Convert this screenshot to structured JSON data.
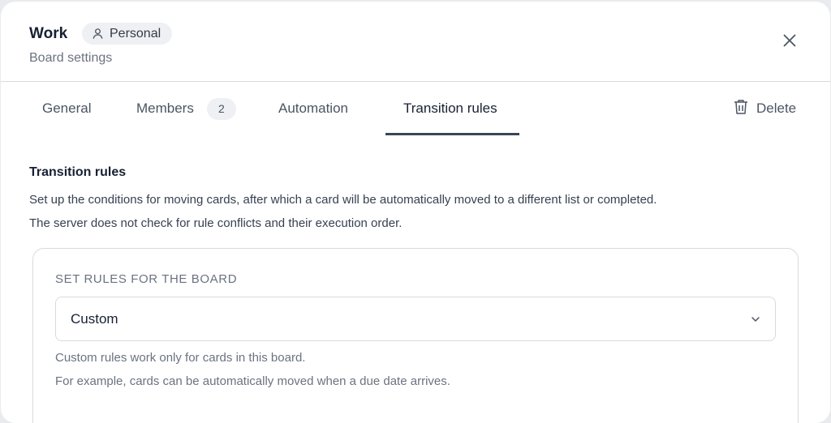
{
  "header": {
    "board_name": "Work",
    "badge_label": "Personal",
    "badge_icon": "user-icon",
    "subtitle": "Board settings",
    "close_icon": "close-icon"
  },
  "tabs": [
    {
      "label": "General",
      "active": false
    },
    {
      "label": "Members",
      "count": "2",
      "active": false
    },
    {
      "label": "Automation",
      "active": false
    },
    {
      "label": "Transition rules",
      "active": true
    }
  ],
  "delete_action": {
    "label": "Delete",
    "icon": "trash-icon"
  },
  "transition_rules": {
    "title": "Transition rules",
    "description_line1": "Set up the conditions for moving cards, after which a card will be automatically moved to a different list or completed.",
    "description_line2": "The server does not check for rule conflicts and their execution order.",
    "card": {
      "label": "SET RULES FOR THE BOARD",
      "select_value": "Custom",
      "hint_line1": "Custom rules work only for cards in this board.",
      "hint_line2": "For example, cards can be automatically moved when a due date arrives."
    }
  },
  "colors": {
    "text_primary": "#172033",
    "text_secondary": "#6b7280",
    "border": "#d7dadf",
    "badge_bg": "#eef0f3",
    "active_tab_underline": "#3a4556"
  }
}
